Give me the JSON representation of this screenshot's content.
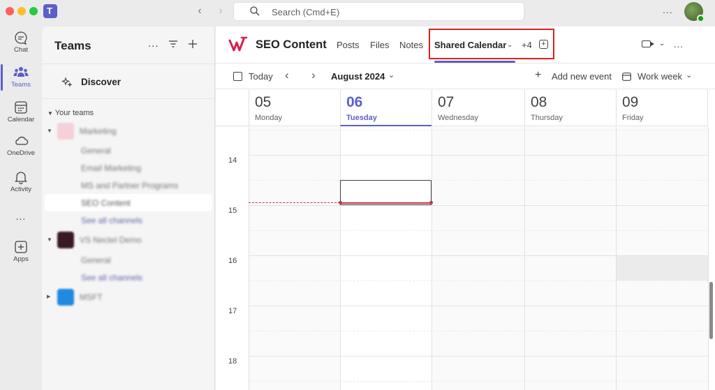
{
  "titlebar": {
    "search_placeholder": "Search (Cmd+E)",
    "more_label": "..."
  },
  "rail": {
    "items": [
      {
        "label": "Chat",
        "icon": "chat-icon"
      },
      {
        "label": "Teams",
        "icon": "teams-icon",
        "active": true
      },
      {
        "label": "Calendar",
        "icon": "calendar-icon"
      },
      {
        "label": "OneDrive",
        "icon": "cloud-icon"
      },
      {
        "label": "Activity",
        "icon": "bell-icon"
      },
      {
        "label": "...",
        "icon": "more-icon"
      },
      {
        "label": "Apps",
        "icon": "apps-icon"
      }
    ],
    "accent": "#5b5fc7"
  },
  "teams_panel": {
    "title": "Teams",
    "more_label": "...",
    "discover_label": "Discover",
    "your_teams_label": "Your teams",
    "tree": [
      {
        "kind": "team",
        "label": "Marketing"
      },
      {
        "kind": "channel",
        "label": "General"
      },
      {
        "kind": "channel",
        "label": "Email Marketing"
      },
      {
        "kind": "channel",
        "label": "MS and Partner Programs"
      },
      {
        "kind": "channel",
        "label": "SEO Content",
        "selected": true
      },
      {
        "kind": "link",
        "label": "See all channels"
      },
      {
        "kind": "team",
        "label": "VS Nectel Demo"
      },
      {
        "kind": "channel",
        "label": "General"
      },
      {
        "kind": "link",
        "label": "See all channels"
      },
      {
        "kind": "team",
        "label": "MSFT"
      }
    ]
  },
  "channel": {
    "name": "SEO Content",
    "tabs": [
      "Posts",
      "Files",
      "Notes"
    ],
    "active_tab": "Shared Calendar",
    "more_tabs": "+4",
    "more_label": "..."
  },
  "calendar": {
    "today_label": "Today",
    "month_label": "August 2024",
    "add_event_label": "Add new event",
    "view_label": "Work week",
    "days": [
      {
        "num": "05",
        "weekday": "Monday"
      },
      {
        "num": "06",
        "weekday": "Tuesday",
        "today": true
      },
      {
        "num": "07",
        "weekday": "Wednesday"
      },
      {
        "num": "08",
        "weekday": "Thursday"
      },
      {
        "num": "09",
        "weekday": "Friday"
      }
    ],
    "hours": [
      "14",
      "15",
      "16",
      "17",
      "18"
    ],
    "now_line_color": "#c4314b",
    "highlight_color": "#e0201b"
  }
}
